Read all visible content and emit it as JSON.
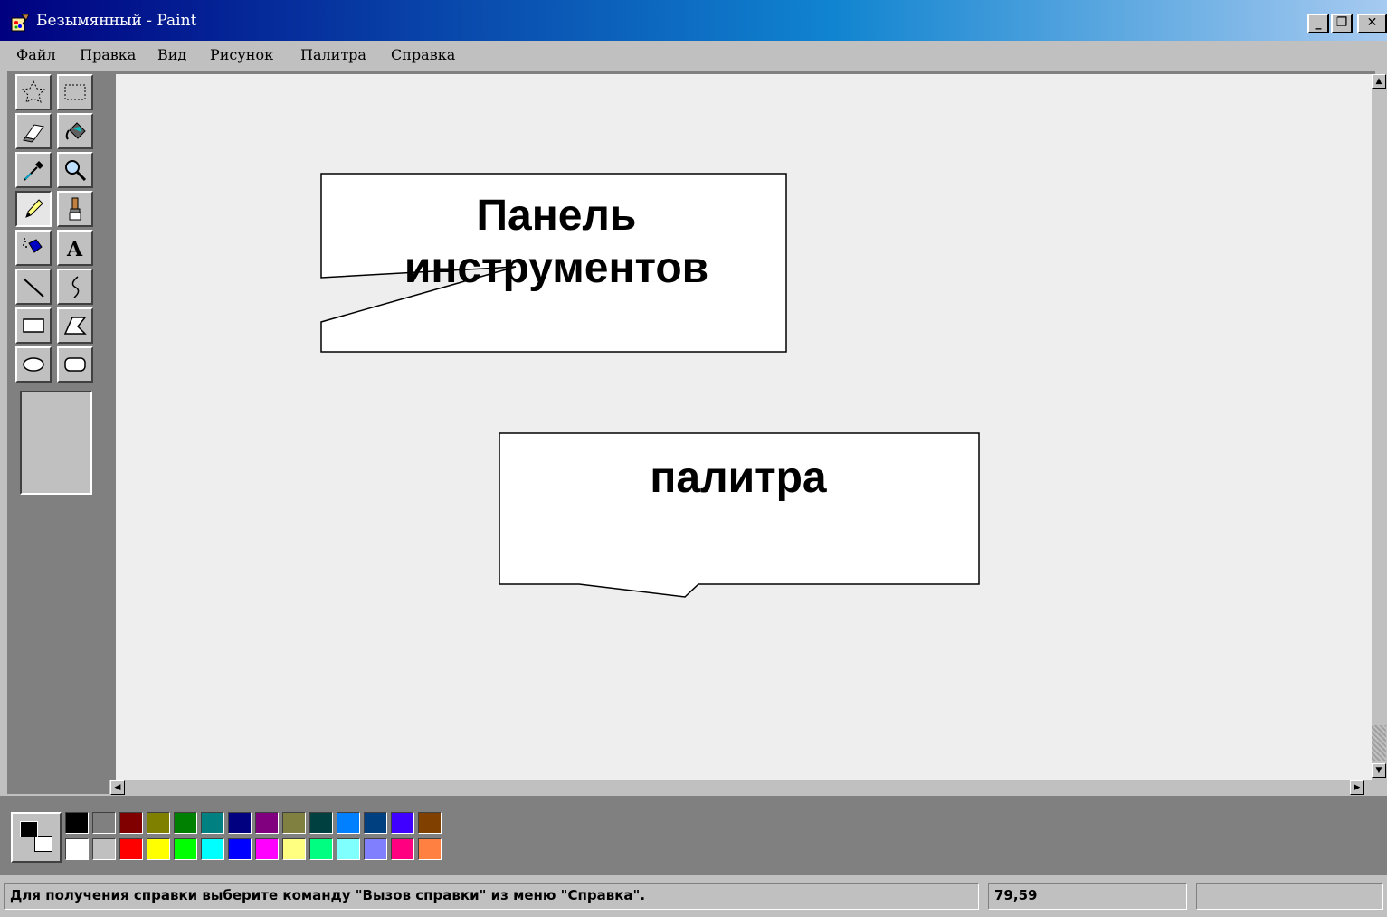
{
  "window": {
    "title": "Безымянный - Paint",
    "app_icon": "paint-icon",
    "controls": [
      "_",
      "❐",
      "✕"
    ]
  },
  "menu": {
    "items": [
      {
        "label": "Файл"
      },
      {
        "label": "Правка"
      },
      {
        "label": "Вид"
      },
      {
        "label": "Рисунок"
      },
      {
        "label": "Палитра"
      },
      {
        "label": "Справка"
      }
    ]
  },
  "toolbox": {
    "tools": [
      {
        "name": "free-form-select",
        "icon": "free-select-icon"
      },
      {
        "name": "select",
        "icon": "rect-select-icon"
      },
      {
        "name": "eraser",
        "icon": "eraser-icon"
      },
      {
        "name": "fill",
        "icon": "fill-bucket-icon"
      },
      {
        "name": "pick-color",
        "icon": "eyedropper-icon"
      },
      {
        "name": "magnifier",
        "icon": "magnifier-icon"
      },
      {
        "name": "pencil",
        "icon": "pencil-icon",
        "active": true
      },
      {
        "name": "brush",
        "icon": "brush-icon"
      },
      {
        "name": "airbrush",
        "icon": "airbrush-icon"
      },
      {
        "name": "text",
        "icon": "text-icon"
      },
      {
        "name": "line",
        "icon": "line-icon"
      },
      {
        "name": "curve",
        "icon": "curve-icon"
      },
      {
        "name": "rectangle",
        "icon": "rectangle-icon"
      },
      {
        "name": "polygon",
        "icon": "polygon-icon"
      },
      {
        "name": "ellipse",
        "icon": "ellipse-icon"
      },
      {
        "name": "rounded-rectangle",
        "icon": "rounded-rect-icon"
      }
    ]
  },
  "callouts": {
    "toolbox_label": "Панель инструментов",
    "palette_label": "палитра"
  },
  "palette": {
    "foreground": "#000000",
    "background": "#ffffff",
    "top_row": [
      "#000000",
      "#808080",
      "#800000",
      "#808000",
      "#008000",
      "#008080",
      "#000080",
      "#800080",
      "#808040",
      "#004040",
      "#0080ff",
      "#004080",
      "#4000ff",
      "#804000"
    ],
    "bottom_row": [
      "#ffffff",
      "#c0c0c0",
      "#ff0000",
      "#ffff00",
      "#00ff00",
      "#00ffff",
      "#0000ff",
      "#ff00ff",
      "#ffff80",
      "#00ff80",
      "#80ffff",
      "#8080ff",
      "#ff0080",
      "#ff8040"
    ]
  },
  "status": {
    "help": "Для получения справки выберите команду \"Вызов справки\" из меню \"Справка\".",
    "coords": "79,59",
    "size": ""
  },
  "colors": {
    "titlebar_start": "#000080",
    "titlebar_end": "#a6caf0",
    "face": "#c0c0c0",
    "workspace": "#808080",
    "canvas": "#eeeeee"
  }
}
